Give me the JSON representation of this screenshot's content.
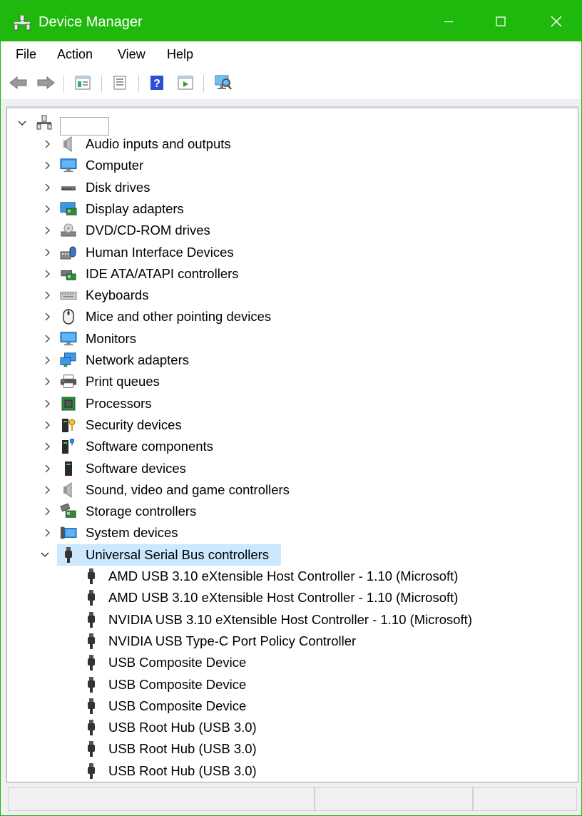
{
  "window": {
    "title": "Device Manager",
    "accent_color": "#1fb80c",
    "app_icon": "device-manager-icon"
  },
  "menubar": {
    "items": [
      "File",
      "Action",
      "View",
      "Help"
    ]
  },
  "toolbar": {
    "buttons": [
      "back-arrow-icon",
      "forward-arrow-icon",
      "properties-icon",
      "update-driver-icon",
      "help-icon",
      "run-icon",
      "scan-hardware-icon"
    ]
  },
  "tree": {
    "root_label": "",
    "categories": [
      {
        "label": "Audio inputs and outputs",
        "icon": "speaker-icon",
        "expanded": false
      },
      {
        "label": "Computer",
        "icon": "computer-icon",
        "expanded": false
      },
      {
        "label": "Disk drives",
        "icon": "disk-drive-icon",
        "expanded": false
      },
      {
        "label": "Display adapters",
        "icon": "display-adapter-icon",
        "expanded": false
      },
      {
        "label": "DVD/CD-ROM drives",
        "icon": "dvd-drive-icon",
        "expanded": false
      },
      {
        "label": "Human Interface Devices",
        "icon": "hid-icon",
        "expanded": false
      },
      {
        "label": "IDE ATA/ATAPI controllers",
        "icon": "ide-controller-icon",
        "expanded": false
      },
      {
        "label": "Keyboards",
        "icon": "keyboard-icon",
        "expanded": false
      },
      {
        "label": "Mice and other pointing devices",
        "icon": "mouse-icon",
        "expanded": false
      },
      {
        "label": "Monitors",
        "icon": "monitor-icon",
        "expanded": false
      },
      {
        "label": "Network adapters",
        "icon": "network-adapter-icon",
        "expanded": false
      },
      {
        "label": "Print queues",
        "icon": "printer-icon",
        "expanded": false
      },
      {
        "label": "Processors",
        "icon": "processor-icon",
        "expanded": false
      },
      {
        "label": "Security devices",
        "icon": "security-device-icon",
        "expanded": false
      },
      {
        "label": "Software components",
        "icon": "software-component-icon",
        "expanded": false
      },
      {
        "label": "Software devices",
        "icon": "software-device-icon",
        "expanded": false
      },
      {
        "label": "Sound, video and game controllers",
        "icon": "sound-controller-icon",
        "expanded": false
      },
      {
        "label": "Storage controllers",
        "icon": "storage-controller-icon",
        "expanded": false
      },
      {
        "label": "System devices",
        "icon": "system-devices-icon",
        "expanded": false
      },
      {
        "label": "Universal Serial Bus controllers",
        "icon": "usb-icon",
        "expanded": true,
        "selected": true
      }
    ],
    "usb_children": [
      "AMD USB 3.10 eXtensible Host Controller - 1.10 (Microsoft)",
      "AMD USB 3.10 eXtensible Host Controller - 1.10 (Microsoft)",
      "NVIDIA USB 3.10 eXtensible Host Controller - 1.10 (Microsoft)",
      "NVIDIA USB Type-C Port Policy Controller",
      "USB Composite Device",
      "USB Composite Device",
      "USB Composite Device",
      "USB Root Hub (USB 3.0)",
      "USB Root Hub (USB 3.0)",
      "USB Root Hub (USB 3.0)"
    ]
  }
}
